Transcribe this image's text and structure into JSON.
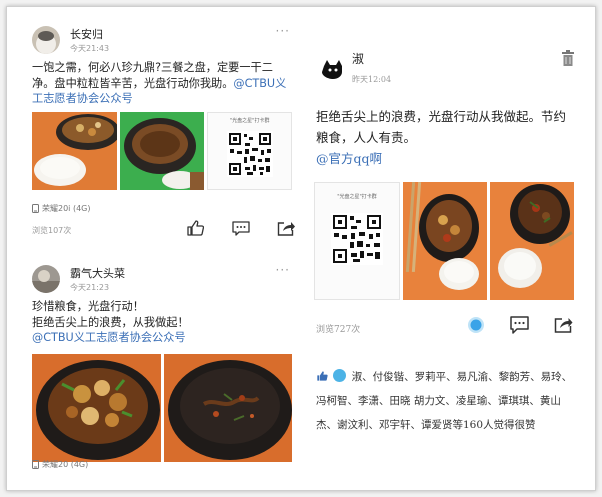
{
  "post1": {
    "username": "长安归",
    "time": "今天21:43",
    "more": "···",
    "text_main": "一饱之需，何必八珍九鼎?三餐之盘，定要一干二净。盘中粒粒皆辛苦，光盘行动你我助。",
    "text_link": "@CTBU义工志愿者协会公众号",
    "qr_title": "\"光盘之星\"打卡群",
    "device": "荣耀20i (4G)",
    "views": "浏览107次"
  },
  "post2": {
    "username": "霸气大头菜",
    "time": "今天21:23",
    "more": "···",
    "line1": "珍惜粮食，光盘行动！",
    "line2": "拒绝舌尖上的浪费，从我做起！",
    "text_link": "@CTBU义工志愿者协会公众号",
    "device": "荣耀20 (4G)"
  },
  "post3": {
    "username": "淑",
    "time": "昨天12:04",
    "text_main": "拒绝舌尖上的浪费，光盘行动从我做起。节约粮食，人人有责。",
    "text_link": "@官方qq啊",
    "qr_title": "\"光盘之星\"打卡群",
    "views": "浏览727次",
    "likes_names": "淑、付俊锴、罗莉平、易凡渝、黎韵芳、易玲、冯柯智、李潇、田晓 胡力文、凌星瑜、谭琪琪、黄山杰、谢汶利、邓宇轩、谭爱贤等160人觉得很赞"
  },
  "colors": {
    "link": "#3b6fb6",
    "like_active": "#3aa3e8",
    "tray_orange": "#e8823c",
    "tray_green": "#3cae4e"
  },
  "icons": [
    "more-icon",
    "like-icon",
    "comment-icon",
    "share-icon",
    "phone-icon",
    "trash-icon",
    "qr-code-icon"
  ]
}
